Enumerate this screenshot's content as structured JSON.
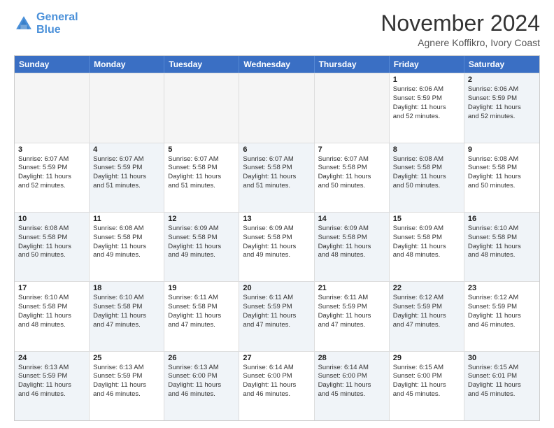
{
  "header": {
    "logo_line1": "General",
    "logo_line2": "Blue",
    "month_title": "November 2024",
    "location": "Agnere Koffikro, Ivory Coast"
  },
  "weekdays": [
    "Sunday",
    "Monday",
    "Tuesday",
    "Wednesday",
    "Thursday",
    "Friday",
    "Saturday"
  ],
  "rows": [
    [
      {
        "day": "",
        "info": "",
        "empty": true
      },
      {
        "day": "",
        "info": "",
        "empty": true
      },
      {
        "day": "",
        "info": "",
        "empty": true
      },
      {
        "day": "",
        "info": "",
        "empty": true
      },
      {
        "day": "",
        "info": "",
        "empty": true
      },
      {
        "day": "1",
        "info": "Sunrise: 6:06 AM\nSunset: 5:59 PM\nDaylight: 11 hours\nand 52 minutes.",
        "alt": false
      },
      {
        "day": "2",
        "info": "Sunrise: 6:06 AM\nSunset: 5:59 PM\nDaylight: 11 hours\nand 52 minutes.",
        "alt": true
      }
    ],
    [
      {
        "day": "3",
        "info": "Sunrise: 6:07 AM\nSunset: 5:59 PM\nDaylight: 11 hours\nand 52 minutes.",
        "alt": false
      },
      {
        "day": "4",
        "info": "Sunrise: 6:07 AM\nSunset: 5:59 PM\nDaylight: 11 hours\nand 51 minutes.",
        "alt": true
      },
      {
        "day": "5",
        "info": "Sunrise: 6:07 AM\nSunset: 5:58 PM\nDaylight: 11 hours\nand 51 minutes.",
        "alt": false
      },
      {
        "day": "6",
        "info": "Sunrise: 6:07 AM\nSunset: 5:58 PM\nDaylight: 11 hours\nand 51 minutes.",
        "alt": true
      },
      {
        "day": "7",
        "info": "Sunrise: 6:07 AM\nSunset: 5:58 PM\nDaylight: 11 hours\nand 50 minutes.",
        "alt": false
      },
      {
        "day": "8",
        "info": "Sunrise: 6:08 AM\nSunset: 5:58 PM\nDaylight: 11 hours\nand 50 minutes.",
        "alt": true
      },
      {
        "day": "9",
        "info": "Sunrise: 6:08 AM\nSunset: 5:58 PM\nDaylight: 11 hours\nand 50 minutes.",
        "alt": false
      }
    ],
    [
      {
        "day": "10",
        "info": "Sunrise: 6:08 AM\nSunset: 5:58 PM\nDaylight: 11 hours\nand 50 minutes.",
        "alt": true
      },
      {
        "day": "11",
        "info": "Sunrise: 6:08 AM\nSunset: 5:58 PM\nDaylight: 11 hours\nand 49 minutes.",
        "alt": false
      },
      {
        "day": "12",
        "info": "Sunrise: 6:09 AM\nSunset: 5:58 PM\nDaylight: 11 hours\nand 49 minutes.",
        "alt": true
      },
      {
        "day": "13",
        "info": "Sunrise: 6:09 AM\nSunset: 5:58 PM\nDaylight: 11 hours\nand 49 minutes.",
        "alt": false
      },
      {
        "day": "14",
        "info": "Sunrise: 6:09 AM\nSunset: 5:58 PM\nDaylight: 11 hours\nand 48 minutes.",
        "alt": true
      },
      {
        "day": "15",
        "info": "Sunrise: 6:09 AM\nSunset: 5:58 PM\nDaylight: 11 hours\nand 48 minutes.",
        "alt": false
      },
      {
        "day": "16",
        "info": "Sunrise: 6:10 AM\nSunset: 5:58 PM\nDaylight: 11 hours\nand 48 minutes.",
        "alt": true
      }
    ],
    [
      {
        "day": "17",
        "info": "Sunrise: 6:10 AM\nSunset: 5:58 PM\nDaylight: 11 hours\nand 48 minutes.",
        "alt": false
      },
      {
        "day": "18",
        "info": "Sunrise: 6:10 AM\nSunset: 5:58 PM\nDaylight: 11 hours\nand 47 minutes.",
        "alt": true
      },
      {
        "day": "19",
        "info": "Sunrise: 6:11 AM\nSunset: 5:58 PM\nDaylight: 11 hours\nand 47 minutes.",
        "alt": false
      },
      {
        "day": "20",
        "info": "Sunrise: 6:11 AM\nSunset: 5:59 PM\nDaylight: 11 hours\nand 47 minutes.",
        "alt": true
      },
      {
        "day": "21",
        "info": "Sunrise: 6:11 AM\nSunset: 5:59 PM\nDaylight: 11 hours\nand 47 minutes.",
        "alt": false
      },
      {
        "day": "22",
        "info": "Sunrise: 6:12 AM\nSunset: 5:59 PM\nDaylight: 11 hours\nand 47 minutes.",
        "alt": true
      },
      {
        "day": "23",
        "info": "Sunrise: 6:12 AM\nSunset: 5:59 PM\nDaylight: 11 hours\nand 46 minutes.",
        "alt": false
      }
    ],
    [
      {
        "day": "24",
        "info": "Sunrise: 6:13 AM\nSunset: 5:59 PM\nDaylight: 11 hours\nand 46 minutes.",
        "alt": true
      },
      {
        "day": "25",
        "info": "Sunrise: 6:13 AM\nSunset: 5:59 PM\nDaylight: 11 hours\nand 46 minutes.",
        "alt": false
      },
      {
        "day": "26",
        "info": "Sunrise: 6:13 AM\nSunset: 6:00 PM\nDaylight: 11 hours\nand 46 minutes.",
        "alt": true
      },
      {
        "day": "27",
        "info": "Sunrise: 6:14 AM\nSunset: 6:00 PM\nDaylight: 11 hours\nand 46 minutes.",
        "alt": false
      },
      {
        "day": "28",
        "info": "Sunrise: 6:14 AM\nSunset: 6:00 PM\nDaylight: 11 hours\nand 45 minutes.",
        "alt": true
      },
      {
        "day": "29",
        "info": "Sunrise: 6:15 AM\nSunset: 6:00 PM\nDaylight: 11 hours\nand 45 minutes.",
        "alt": false
      },
      {
        "day": "30",
        "info": "Sunrise: 6:15 AM\nSunset: 6:01 PM\nDaylight: 11 hours\nand 45 minutes.",
        "alt": true
      }
    ]
  ]
}
